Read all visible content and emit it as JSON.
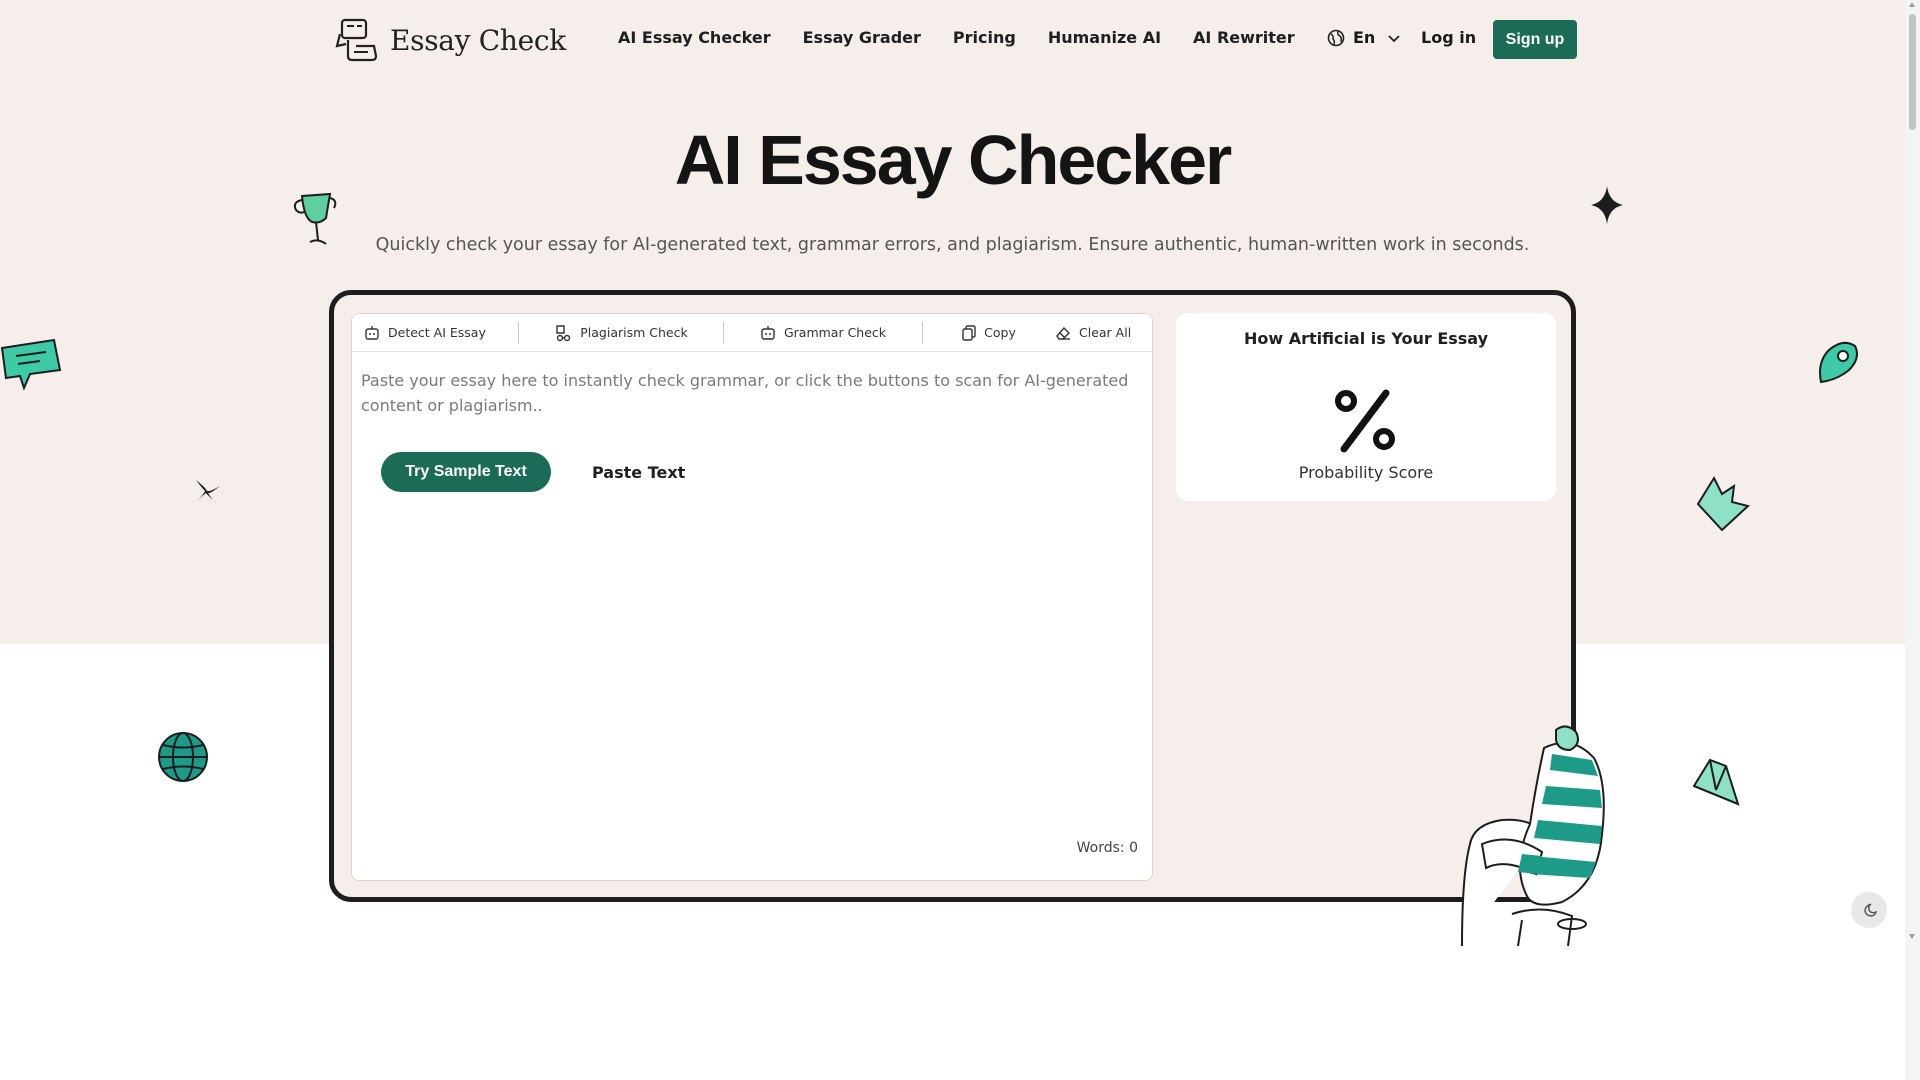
{
  "brand": {
    "name": "Essay Check"
  },
  "nav": {
    "items": [
      {
        "label": "AI Essay Checker"
      },
      {
        "label": "Essay Grader"
      },
      {
        "label": "Pricing"
      },
      {
        "label": "Humanize AI"
      },
      {
        "label": "AI Rewriter"
      }
    ],
    "language": "En",
    "login": "Log in",
    "signup": "Sign up"
  },
  "hero": {
    "title": "AI Essay Checker",
    "subtitle": "Quickly check your essay for AI-generated text, grammar errors, and plagiarism. Ensure authentic, human-written work in seconds."
  },
  "toolbar": {
    "detect": "Detect AI Essay",
    "plagiarism": "Plagiarism Check",
    "grammar": "Grammar Check",
    "copy": "Copy",
    "clear": "Clear All"
  },
  "editor": {
    "placeholder": "Paste your essay here to instantly check grammar, or click the buttons to scan for AI-generated content or plagiarism..",
    "sample_button": "Try Sample Text",
    "paste_button": "Paste Text",
    "word_count": "Words: 0"
  },
  "result": {
    "title": "How Artificial is Your Essay",
    "symbol": "%",
    "score_label": "Probability Score"
  },
  "colors": {
    "accent": "#1c6b56",
    "hero_bg": "#f5eeea",
    "deco_teal": "#3ec9a7"
  }
}
